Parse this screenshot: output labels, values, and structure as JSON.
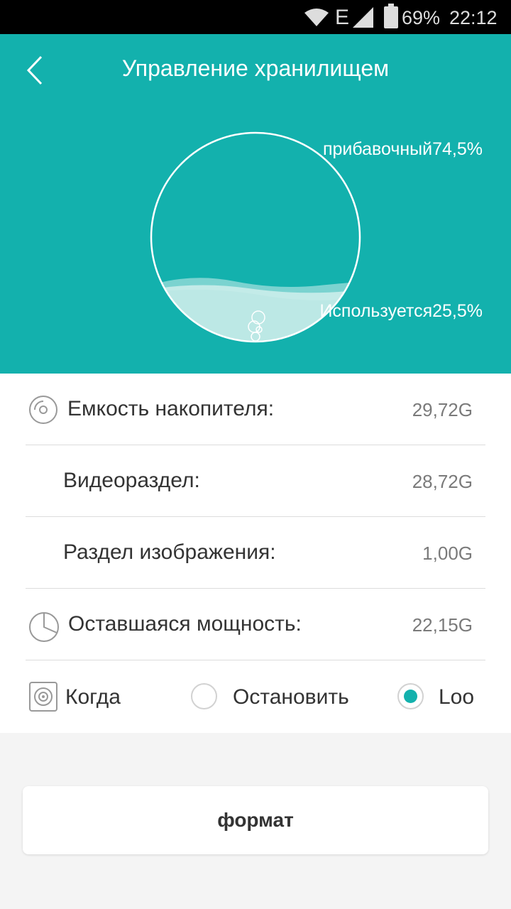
{
  "status_bar": {
    "network": "E",
    "battery": "69%",
    "time": "22:12",
    "icons": [
      "wifi-icon",
      "signal-icon",
      "battery-icon"
    ]
  },
  "header": {
    "title": "Управление хранилищем",
    "back_icon": "chevron-left-icon",
    "background": "#13b1ad"
  },
  "storage_gauge": {
    "free_label": "прибавочный74,5%",
    "used_label": "Используется25,5%",
    "used_fraction": 0.255
  },
  "details": [
    {
      "label": "Емкость накопителя:",
      "value": "29,72G",
      "icon": "disc-icon"
    },
    {
      "label": "Видеораздел:",
      "value": "28,72G"
    },
    {
      "label": "Раздел изображения:",
      "value": "1,00G"
    },
    {
      "label": "Оставшаяся мощность:",
      "value": "22,15G",
      "icon": "pie-chart-icon"
    }
  ],
  "record_mode": {
    "label": "Когда",
    "icon": "speaker-icon",
    "options": [
      {
        "label": "Остановить",
        "selected": false
      },
      {
        "label": "Loo",
        "selected": true
      }
    ]
  },
  "format_button": {
    "label": "формат"
  },
  "colors": {
    "accent": "#13b1ad",
    "text": "#333333",
    "value": "#7a7a7a"
  }
}
